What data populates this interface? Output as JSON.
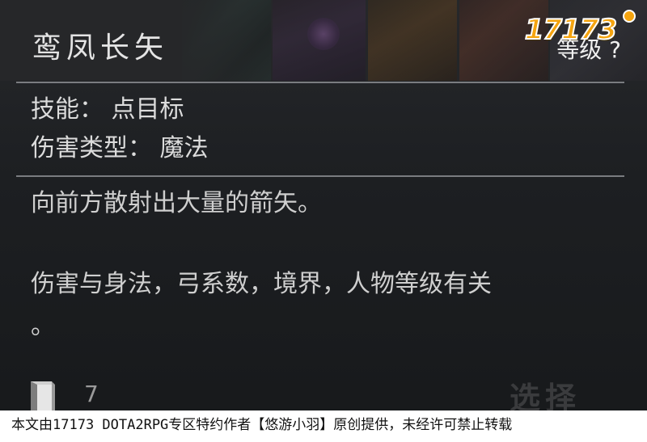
{
  "tooltip": {
    "title": "鸾凤长矢",
    "level_label": "等级 ?",
    "logo_text": "17173",
    "info": {
      "skill_line": "技能： 点目标",
      "damage_type_line": "伤害类型： 魔法"
    },
    "description": {
      "line_1": "向前方散射出大量的箭矢。",
      "line_2": "伤害与身法，弓系数，境界，人物等级有关",
      "line_3": "。"
    },
    "footer": {
      "cost_icon": "book-icon",
      "cost_value": "7",
      "select_label": "选择"
    },
    "watermark": "本文由17173 DOTA2RPG专区特约作者【悠游小羽】原创提供，未经许可禁止转载"
  },
  "colors": {
    "background": "#1d1f22",
    "text": "#d6d6d6",
    "divider": "#7a7c80",
    "logo": "#f5a40f"
  }
}
